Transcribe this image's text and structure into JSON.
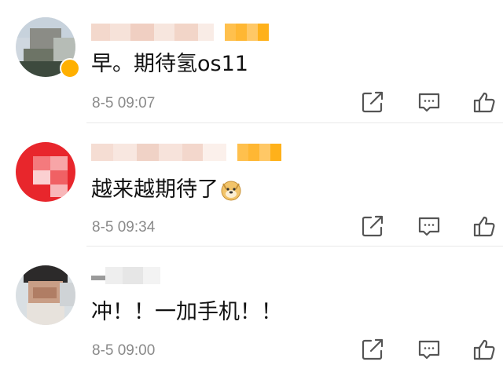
{
  "comments": [
    {
      "text": "早。期待氢os11",
      "time": "8-5 09:07",
      "has_emoji": false
    },
    {
      "text": "越来越期待了",
      "time": "8-5 09:34",
      "has_emoji": true,
      "emoji": "doge-emoji"
    },
    {
      "text": "冲！！一加手机！！",
      "time": "8-5 09:00",
      "has_emoji": false
    }
  ],
  "icons": {
    "share": "share-icon",
    "reply": "comment-icon",
    "like": "thumbs-up-icon"
  },
  "colors": {
    "text": "#111111",
    "meta": "#8a8a8a",
    "icon": "#555555",
    "vip_gold": "#ffb000"
  }
}
